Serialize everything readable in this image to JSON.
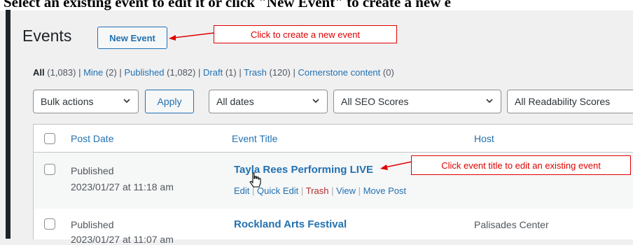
{
  "instruction": "Select an existing event to edit it or click \"New Event\" to create a new e",
  "page": {
    "title": "Events",
    "new_button": "New Event"
  },
  "annotations": {
    "new_event": "Click to create a new event",
    "edit_event": "Click event title to edit an existing event",
    "color": "#e00000"
  },
  "filters": {
    "all": "All",
    "all_count": "(1,083)",
    "mine": "Mine",
    "mine_count": "(2)",
    "published": "Published",
    "published_count": "(1,082)",
    "draft": "Draft",
    "draft_count": "(1)",
    "trash": "Trash",
    "trash_count": "(120)",
    "cornerstone": "Cornerstone content",
    "cornerstone_count": "(0)",
    "separator": "|"
  },
  "toolbar": {
    "bulk_actions": "Bulk actions",
    "apply": "Apply",
    "dates": "All dates",
    "seo": "All SEO Scores",
    "readability": "All Readability Scores"
  },
  "table": {
    "headers": {
      "date": "Post Date",
      "title": "Event Title",
      "host": "Host"
    },
    "rows": [
      {
        "status": "Published",
        "datetime": "2023/01/27 at 11:18 am",
        "title": "Tayla Rees Performing LIVE",
        "host": "",
        "actions": {
          "edit": "Edit",
          "quick_edit": "Quick Edit",
          "trash": "Trash",
          "view": "View",
          "move": "Move Post"
        }
      },
      {
        "status": "Published",
        "datetime": "2023/01/27 at 11:07 am",
        "title": "Rockland Arts Festival",
        "host": "Palisades Center"
      }
    ]
  },
  "colors": {
    "link": "#2271b1",
    "trash": "#b32d2e",
    "dark_bar": "#1d2327"
  }
}
